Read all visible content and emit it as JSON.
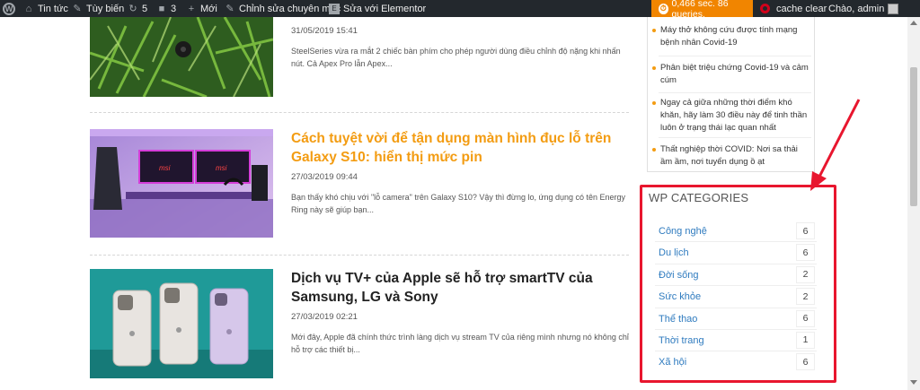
{
  "adminbar": {
    "site_name": "Tin tức",
    "customize": "Tùy biến",
    "updates_count": "5",
    "comments_count": "3",
    "new_label": "Mới",
    "edit_category": "Chỉnh sửa chuyên mục",
    "elementor": "Sửa với Elementor",
    "query_monitor": "0,466 sec. 86 queries.",
    "cache_clear": "cache clear",
    "greeting": "Chào, admin"
  },
  "posts": [
    {
      "title": "",
      "date": "31/05/2019 15:41",
      "excerpt": "SteelSeries vừa ra mắt 2 chiếc bàn phím cho phép người dùng điều chỉnh độ nặng khi nhấn nút. Cả Apex Pro lẫn Apex..."
    },
    {
      "title": "Cách tuyệt vời để tận dụng màn hình đục lỗ trên Galaxy S10: hiển thị mức pin",
      "date": "27/03/2019 09:44",
      "excerpt": "Bạn thấy khó chịu với \"lỗ camera\" trên Galaxy S10? Vậy thì đừng lo, ứng dụng có tên Energy Ring này sẽ giúp bạn..."
    },
    {
      "title": "Dịch vụ TV+ của Apple sẽ hỗ trợ smartTV của Samsung, LG và Sony",
      "date": "27/03/2019 02:21",
      "excerpt": "Mới đây, Apple đã chính thức trình làng dịch vụ stream TV của riêng mình nhưng nó không chỉ hỗ trợ các thiết bị..."
    }
  ],
  "recent": [
    "Máy thở không cứu được tính mạng bệnh nhân Covid-19",
    "Phân biệt triệu chứng Covid-19 và cảm cúm",
    "Ngay cả giữa những thời điểm khó khăn, hãy làm 30 điều này để tinh thần luôn ở trạng thái lạc quan nhất",
    "Thất nghiệp thời COVID: Nơi sa thải ầm ầm, nơi tuyển dụng ồ ạt"
  ],
  "categories": {
    "title": "WP CATEGORIES",
    "items": [
      {
        "name": "Công nghệ",
        "count": "6"
      },
      {
        "name": "Du lịch",
        "count": "6"
      },
      {
        "name": "Đời sống",
        "count": "2"
      },
      {
        "name": "Sức khỏe",
        "count": "2"
      },
      {
        "name": "Thể thao",
        "count": "6"
      },
      {
        "name": "Thời trang",
        "count": "1"
      },
      {
        "name": "Xã hội",
        "count": "6"
      }
    ]
  },
  "colors": {
    "adminbar_bg": "#23282d",
    "query_monitor_bg": "#f18500",
    "accent_orange": "#f39c12",
    "link_blue": "#2f7bbf",
    "highlight_red": "#e8162e"
  }
}
